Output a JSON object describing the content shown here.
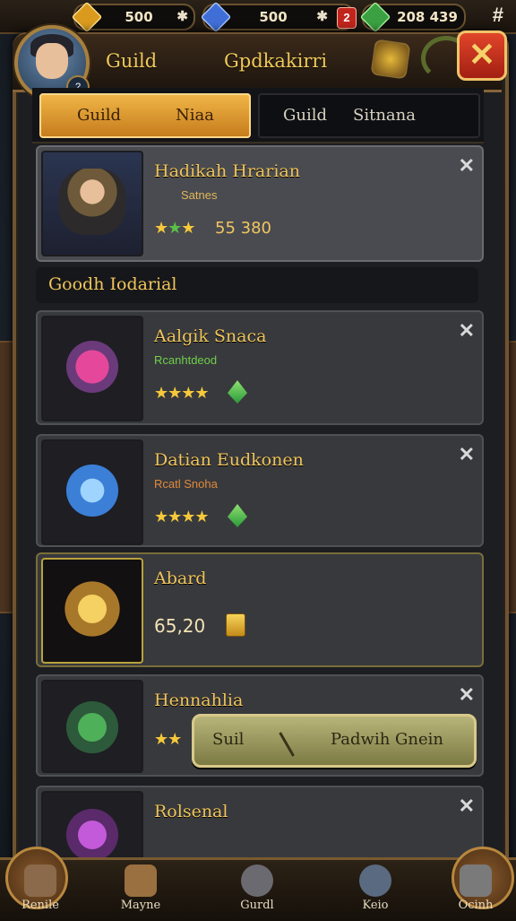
{
  "resources": [
    {
      "value": "500",
      "action": "✱",
      "color": "#d99a1e"
    },
    {
      "value": "500",
      "action": "✱",
      "badge": "2",
      "color": "#3f6fd6"
    },
    {
      "value": "208 439",
      "color": "#3aa041"
    }
  ],
  "resources_end": "#",
  "header": {
    "left_label": "Guild",
    "center_label": "Gpdkakirri",
    "close_icon": "close-icon",
    "avatar_level": "?"
  },
  "tabs": [
    {
      "a": "Guild",
      "b": "Niaa",
      "active": true
    },
    {
      "a": "Guild",
      "b": "Sitnana",
      "active": false
    }
  ],
  "section_title": "Goodh Iodarial",
  "cards": [
    {
      "name": "Hadikah Hrarian",
      "sub": "Satnes",
      "stars": "★",
      "stars_green": "★",
      "stars_end": "★",
      "score": "55 380"
    },
    {
      "name": "Aalgik Snaca",
      "sub": "Rcanhtdeod",
      "stars": "★★★★"
    },
    {
      "name": "Datian Eudkonen",
      "sub": "Rcatl Snoha",
      "stars": "★★★★"
    },
    {
      "name": "Abard",
      "amount": "65,20"
    },
    {
      "name": "Hennahlia",
      "stars": "★★"
    },
    {
      "name": "Rolsenal"
    }
  ],
  "action_button": {
    "left": "Suil",
    "right": "Padwih Gnein"
  },
  "bottom_nav": [
    "Renile",
    "Mayne",
    "Gurdl",
    "Keio",
    "Ocinh"
  ],
  "colors": {
    "accent": "#f0b546",
    "frame": "#6f5431",
    "close": "#e2452a"
  }
}
